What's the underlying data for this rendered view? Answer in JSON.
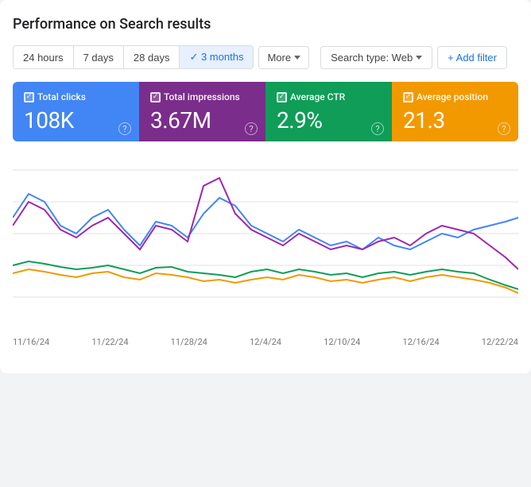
{
  "page": {
    "title": "Performance on Search results"
  },
  "filters": {
    "date_buttons": [
      {
        "label": "24 hours",
        "active": false
      },
      {
        "label": "7 days",
        "active": false
      },
      {
        "label": "28 days",
        "active": false
      },
      {
        "label": "3 months",
        "active": true
      }
    ],
    "more_label": "More",
    "search_type_label": "Search type: Web",
    "add_filter_label": "+ Add filter"
  },
  "metrics": [
    {
      "key": "clicks",
      "checkbox_label": "Total clicks",
      "value": "108K",
      "color": "#4285f4"
    },
    {
      "key": "impressions",
      "checkbox_label": "Total impressions",
      "value": "3.67M",
      "color": "#7b2d8b"
    },
    {
      "key": "ctr",
      "checkbox_label": "Average CTR",
      "value": "2.9%",
      "color": "#0f9d58"
    },
    {
      "key": "position",
      "checkbox_label": "Average position",
      "value": "21.3",
      "color": "#f29900"
    }
  ],
  "chart": {
    "x_labels": [
      "11/16/24",
      "11/22/24",
      "11/28/24",
      "12/4/24",
      "12/10/24",
      "12/16/24",
      "12/22/24"
    ],
    "lines": {
      "clicks_color": "#4285f4",
      "impressions_color": "#7b2d8b",
      "ctr_color": "#0f9d58",
      "position_color": "#f29900"
    }
  }
}
